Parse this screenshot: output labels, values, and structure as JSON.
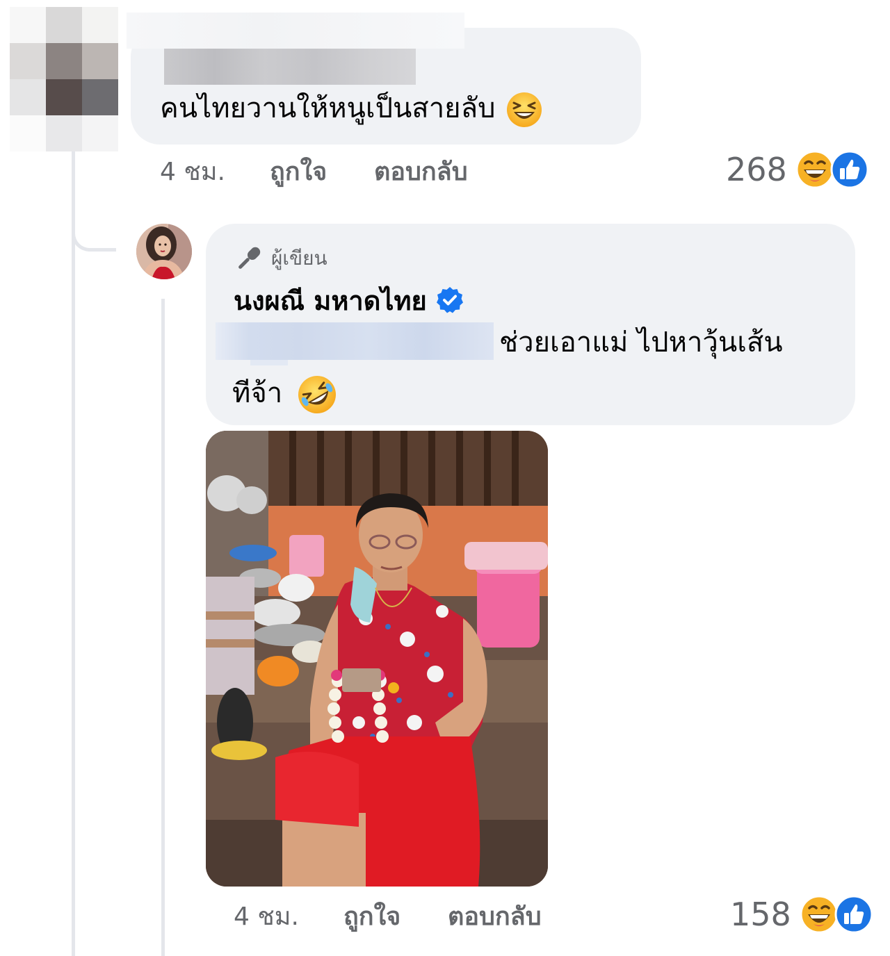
{
  "comment": {
    "text": "คนไทยวานให้หนูเป็นสายลับ",
    "emoji": "laughing-squinting-emoji",
    "time": "4 ชม.",
    "like_label": "ถูกใจ",
    "reply_label": "ตอบกลับ",
    "reaction_count": "268",
    "reactions": [
      "haha",
      "like"
    ]
  },
  "reply": {
    "badge": "ผู้เขียน",
    "author": "นงผณี มหาดไทย",
    "verified": true,
    "text_line1": "ช่วยเอาแม่ ไปหาวุ้นเส้น",
    "text_line2": "ทีจ้า",
    "emoji": "rolling-on-floor-laughing-emoji",
    "photo_icon": "photo-elderly-woman-in-red",
    "time": "4 ชม.",
    "like_label": "ถูกใจ",
    "reply_label": "ตอบกลับ",
    "reaction_count": "158",
    "reactions": [
      "haha",
      "like"
    ]
  },
  "colors": {
    "bubble": "#f0f2f5",
    "secondary_text": "#65676b",
    "like_blue": "#1b74e4",
    "verified_blue": "#1877f2",
    "haha_yellow": "#f7b125"
  }
}
